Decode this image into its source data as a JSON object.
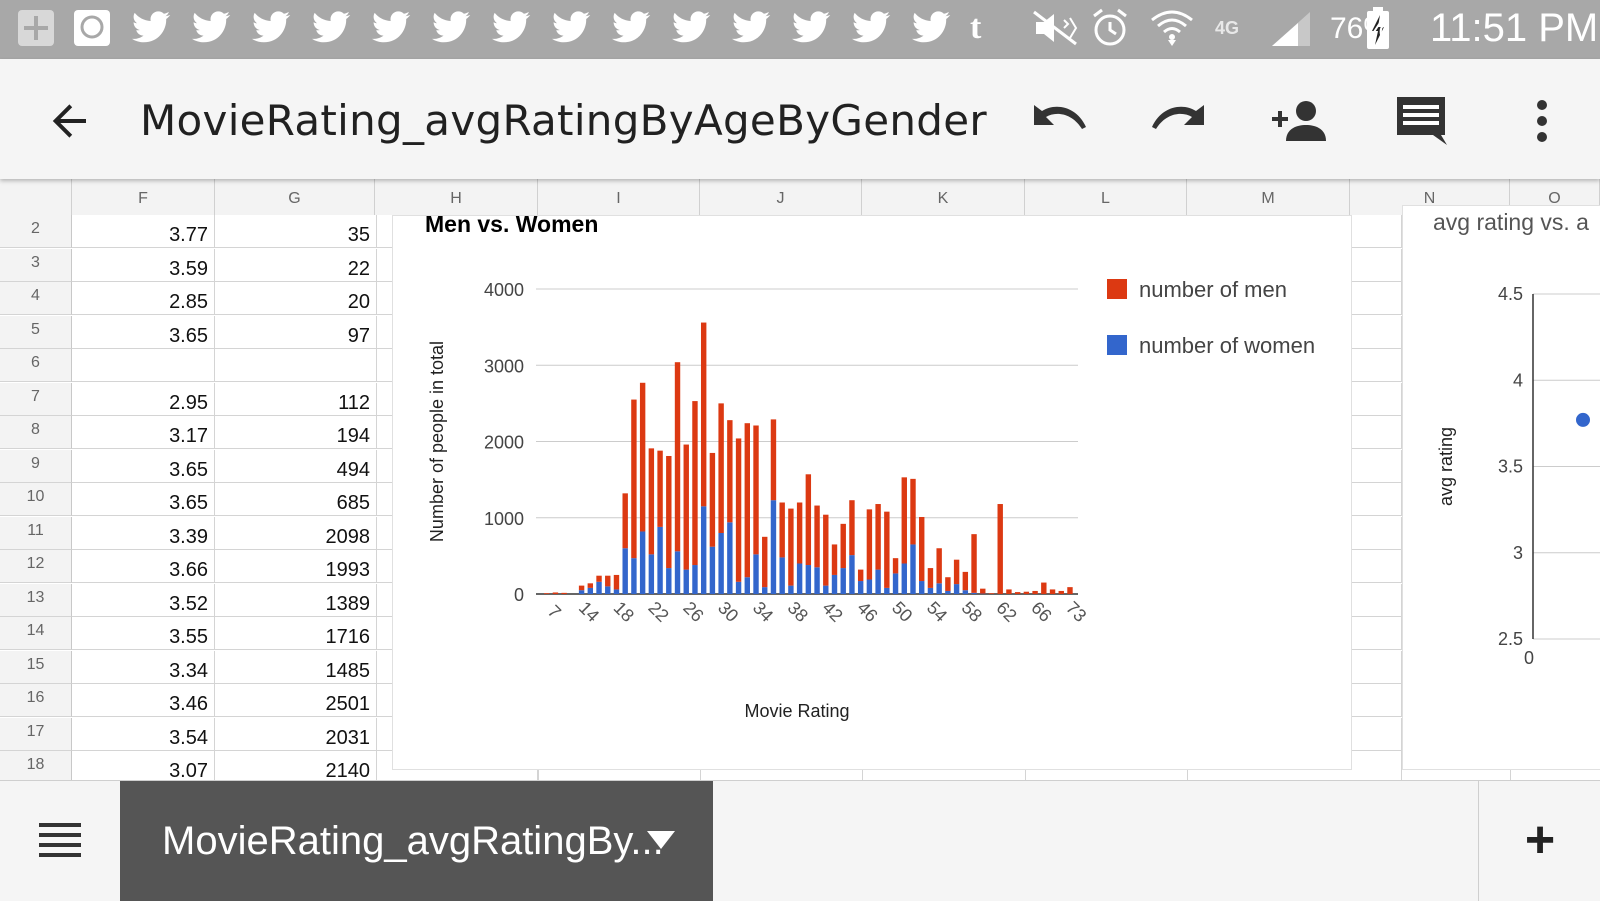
{
  "status_bar": {
    "battery": "76%",
    "time": "11:51 PM",
    "icons": [
      "add-icon",
      "messenger-icon",
      "twitter-icon",
      "twitter-icon",
      "twitter-icon",
      "twitter-icon",
      "twitter-icon",
      "twitter-icon",
      "twitter-icon",
      "twitter-icon",
      "twitter-icon",
      "twitter-icon",
      "twitter-icon",
      "twitter-icon",
      "twitter-icon",
      "twitter-icon",
      "tumblr-icon",
      "mute-icon",
      "alarm-icon",
      "wifi-icon",
      "lte-icon",
      "signal-icon",
      "battery-charging-icon"
    ],
    "tumblr_glyph": "t",
    "lte_glyph": "4G"
  },
  "app_bar": {
    "title": "MovieRating_avgRatingByAgeByGender"
  },
  "columns": [
    "F",
    "G",
    "H",
    "I",
    "J",
    "K",
    "L",
    "M",
    "N",
    "O"
  ],
  "rows": [
    {
      "num": "2",
      "f": "3.77",
      "g": "35"
    },
    {
      "num": "3",
      "f": "3.59",
      "g": "22"
    },
    {
      "num": "4",
      "f": "2.85",
      "g": "20"
    },
    {
      "num": "5",
      "f": "3.65",
      "g": "97"
    },
    {
      "num": "6",
      "f": "",
      "g": ""
    },
    {
      "num": "7",
      "f": "2.95",
      "g": "112"
    },
    {
      "num": "8",
      "f": "3.17",
      "g": "194"
    },
    {
      "num": "9",
      "f": "3.65",
      "g": "494"
    },
    {
      "num": "10",
      "f": "3.65",
      "g": "685"
    },
    {
      "num": "11",
      "f": "3.39",
      "g": "2098"
    },
    {
      "num": "12",
      "f": "3.66",
      "g": "1993"
    },
    {
      "num": "13",
      "f": "3.52",
      "g": "1389"
    },
    {
      "num": "14",
      "f": "3.55",
      "g": "1716"
    },
    {
      "num": "15",
      "f": "3.34",
      "g": "1485"
    },
    {
      "num": "16",
      "f": "3.46",
      "g": "2501"
    },
    {
      "num": "17",
      "f": "3.54",
      "g": "2031"
    },
    {
      "num": "18",
      "f": "3.07",
      "g": "2140"
    }
  ],
  "chart_data": [
    {
      "type": "bar",
      "stacked": true,
      "title": "Men vs. Women",
      "xlabel": "Movie Rating",
      "ylabel": "Number of people in total",
      "ylim": [
        0,
        4000
      ],
      "yticks": [
        "0",
        "1000",
        "2000",
        "3000",
        "4000"
      ],
      "xtick_labels": [
        "7",
        "14",
        "18",
        "22",
        "26",
        "30",
        "34",
        "38",
        "42",
        "46",
        "50",
        "54",
        "58",
        "62",
        "66",
        "73"
      ],
      "legend_position": "right",
      "grid": true,
      "series": [
        {
          "name": "number of women",
          "color": "#3366cc",
          "values": [
            0,
            0,
            0,
            0,
            50,
            80,
            160,
            100,
            60,
            600,
            470,
            820,
            520,
            880,
            340,
            560,
            320,
            380,
            1150,
            620,
            800,
            940,
            160,
            220,
            520,
            90,
            1230,
            480,
            110,
            400,
            380,
            350,
            110,
            250,
            340,
            510,
            170,
            190,
            320,
            80,
            270,
            400,
            650,
            170,
            80,
            140,
            40,
            130,
            50,
            15,
            5,
            0,
            0,
            0,
            0,
            0,
            0,
            0,
            0,
            0,
            0
          ]
        },
        {
          "name": "number of men",
          "color": "#dc3912",
          "values": [
            10,
            20,
            15,
            0,
            60,
            60,
            80,
            140,
            190,
            720,
            2080,
            1950,
            1390,
            1000,
            1470,
            2480,
            1640,
            2150,
            2410,
            1230,
            1700,
            1340,
            1880,
            2020,
            1690,
            660,
            1060,
            720,
            1010,
            800,
            1190,
            810,
            930,
            400,
            580,
            720,
            150,
            920,
            860,
            1000,
            200,
            1130,
            860,
            840,
            260,
            460,
            180,
            320,
            240,
            770,
            65,
            10,
            1180,
            60,
            25,
            30,
            40,
            150,
            60,
            40,
            90
          ]
        }
      ]
    },
    {
      "type": "scatter",
      "title": "avg rating vs. a",
      "ylabel": "avg rating",
      "yticks": [
        "2.5",
        "3",
        "3.5",
        "4",
        "4.5"
      ],
      "xtick_labels": [
        "0"
      ],
      "ylim": [
        2.5,
        4.5
      ],
      "series": [
        {
          "name": "",
          "color": "#3366cc",
          "points": [
            [
              5,
              3.77
            ]
          ]
        }
      ]
    }
  ],
  "bottom_bar": {
    "sheet_tab_label": "MovieRating_avgRatingBy...",
    "add_glyph": "+"
  }
}
